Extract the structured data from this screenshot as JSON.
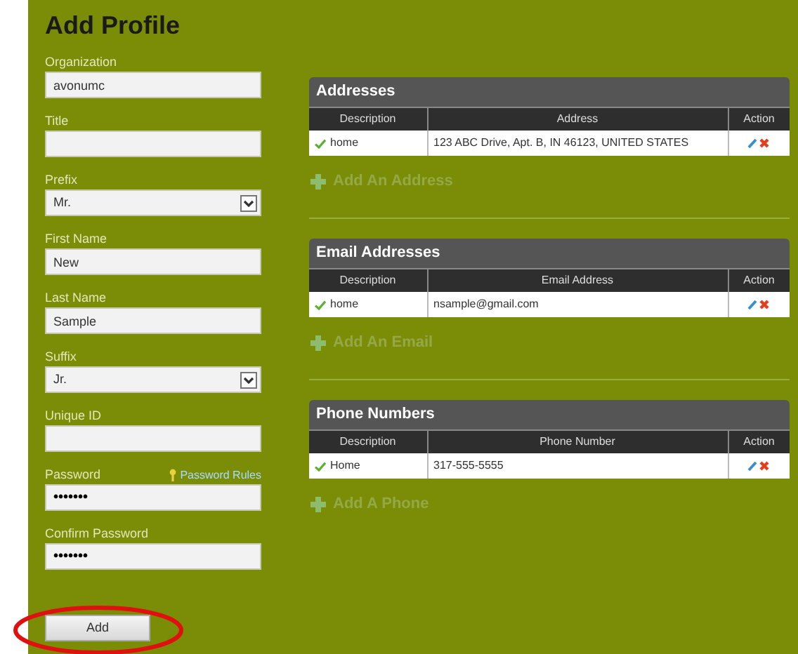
{
  "title": "Add Profile",
  "fields": [
    {
      "kind": "text",
      "label": "Organization",
      "value": "avonumc"
    },
    {
      "kind": "text",
      "label": "Title"
    },
    {
      "kind": "select",
      "label": "Prefix",
      "value": "Mr."
    },
    {
      "kind": "text",
      "label": "First Name",
      "value": "New"
    },
    {
      "kind": "text",
      "label": "Last Name",
      "value": "Sample"
    },
    {
      "kind": "select",
      "label": "Suffix",
      "value": "Jr."
    },
    {
      "kind": "text",
      "label": "Unique ID"
    },
    {
      "kind": "password",
      "label": "Password",
      "value": "•••••••",
      "link": "Password Rules"
    },
    {
      "kind": "password",
      "label": "Confirm Password",
      "value": "•••••••"
    }
  ],
  "submit": "Add",
  "sections": [
    {
      "title": "Addresses",
      "columns": [
        "Description",
        "Address",
        "Action"
      ],
      "rows": [
        {
          "description": "home",
          "value": "123 ABC Drive, Apt. B, IN 46123, UNITED STATES"
        }
      ],
      "add_link": "Add An Address"
    },
    {
      "title": "Email Addresses",
      "columns": [
        "Description",
        "Email Address",
        "Action"
      ],
      "rows": [
        {
          "description": "home",
          "value": "nsample@gmail.com"
        }
      ],
      "add_link": "Add An Email"
    },
    {
      "title": "Phone Numbers",
      "columns": [
        "Description",
        "Phone Number",
        "Action"
      ],
      "rows": [
        {
          "description": "Home",
          "value": "317-555-5555"
        }
      ],
      "add_link": "Add A Phone"
    }
  ]
}
